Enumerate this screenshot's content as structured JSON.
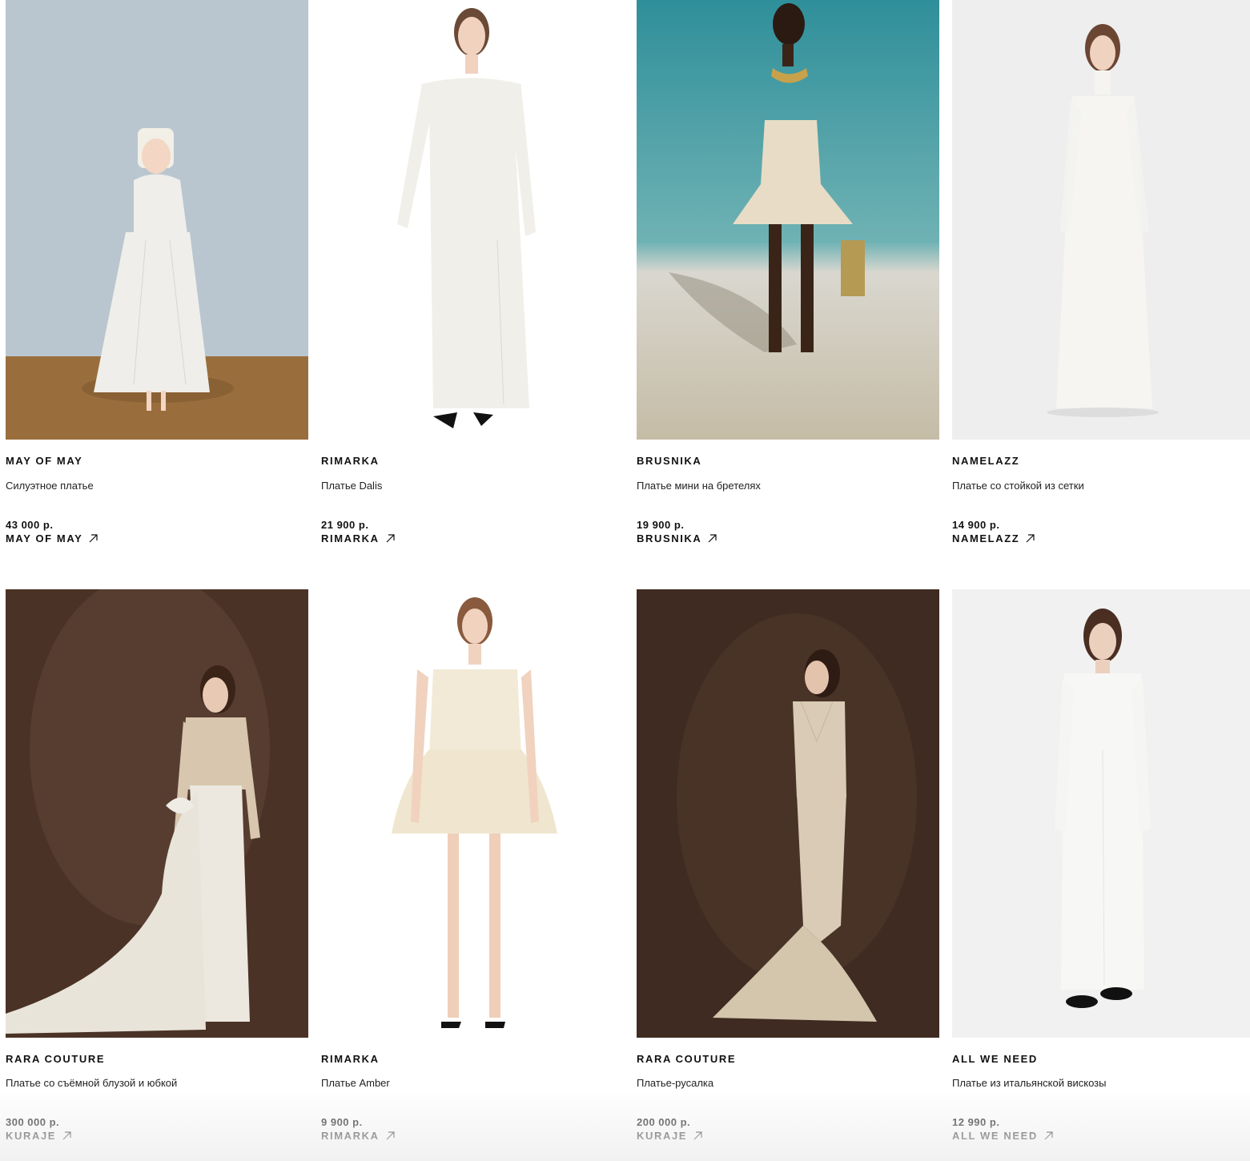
{
  "products": [
    {
      "brand": "MAY OF MAY",
      "title": "Силуэтное платье",
      "price": "43 000 р.",
      "shop": "MAY OF MAY",
      "image": "model-white-satin-midi-dress",
      "colors": {
        "bg": "#b9c6d0",
        "floor": "#9a6e3c",
        "dress": "#efeeea"
      }
    },
    {
      "brand": "RIMARKA",
      "title": "Платье Dalis",
      "price": "21 900 р.",
      "shop": "RIMARKA",
      "image": "model-white-off-shoulder-gown",
      "colors": {
        "bg": "#ffffff",
        "floor": "#ffffff",
        "dress": "#f1efe9"
      }
    },
    {
      "brand": "BRUSNIKA",
      "title": "Платье мини на бретелях",
      "price": "19 900 р.",
      "shop": "BRUSNIKA",
      "image": "model-strapless-mini-on-beach",
      "colors": {
        "bg": "#4f9ea6",
        "floor": "#c9c0aa",
        "dress": "#e8dcc6"
      }
    },
    {
      "brand": "NAMELAZZ",
      "title": "Платье со стойкой из сетки",
      "price": "14 900 р.",
      "shop": "NAMELAZZ",
      "image": "model-mesh-collar-slip-dress",
      "colors": {
        "bg": "#eeeeee",
        "floor": "#f2f2f2",
        "dress": "#f6f5f1"
      }
    },
    {
      "brand": "RARA COUTURE",
      "title": "Платье со съёмной блузой и юбкой",
      "price": "300 000 р.",
      "shop": "KURAJE",
      "image": "model-pearl-blouse-satin-train",
      "colors": {
        "bg": "#4a3326",
        "floor": "#5a3f2e",
        "dress": "#e9e4da"
      }
    },
    {
      "brand": "RIMARKA",
      "title": "Платье Amber",
      "price": "9 900 р.",
      "shop": "RIMARKA",
      "image": "model-ivory-bell-mini-dress",
      "colors": {
        "bg": "#ffffff",
        "floor": "#ffffff",
        "dress": "#f0e6cf"
      }
    },
    {
      "brand": "RARA COUTURE",
      "title": "Платье-русалка",
      "price": "200 000 р.",
      "shop": "KURAJE",
      "image": "model-pearl-mermaid-gown",
      "colors": {
        "bg": "#3f2b21",
        "floor": "#4d372a",
        "dress": "#d9cbb5"
      }
    },
    {
      "brand": "ALL WE NEED",
      "title": "Платье из итальянской вискозы",
      "price": "12 990 р.",
      "shop": "ALL WE NEED",
      "image": "model-long-sleeve-viscose-maxi",
      "colors": {
        "bg": "#f1f1f1",
        "floor": "#f3f3f3",
        "dress": "#f7f7f5"
      }
    }
  ]
}
